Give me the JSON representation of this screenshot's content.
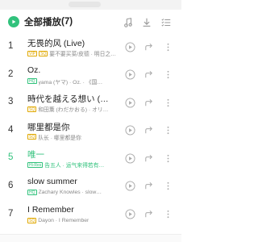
{
  "header": {
    "title": "全部播放",
    "count": "(7)",
    "icons": [
      "playlist-music-icon",
      "download-icon",
      "multi-select-icon"
    ]
  },
  "colors": {
    "accent": "#31c27c",
    "vip": "#e0a800",
    "text": "#222222",
    "sub": "#888888"
  },
  "songs": [
    {
      "num": "1",
      "title": "无畏的风 (Live)",
      "badges": [
        "VIP",
        "SQ"
      ],
      "sub": "要不要买菜/皮德 · 明日之子…"
    },
    {
      "num": "2",
      "title": "Oz.",
      "badges": [
        "HQ"
      ],
      "sub": "yama (ヤマ) · Oz. · 《国…"
    },
    {
      "num": "3",
      "title": "時代を越える想い (穿越…",
      "badges": [
        "SQ"
      ],
      "sub": "和田薫 (わだかおる) · オリ…"
    },
    {
      "num": "4",
      "title": "哪里都是你",
      "badges": [
        "SQ"
      ],
      "sub": "队长 · 哪里都是你"
    },
    {
      "num": "5",
      "title": "唯一",
      "badges": [
        "Hi-Res"
      ],
      "sub": "告五人 · 运气来得若有…"
    },
    {
      "num": "6",
      "title": "slow summer",
      "badges": [
        "HQ"
      ],
      "sub": "Zachary Knowles · slow…"
    },
    {
      "num": "7",
      "title": "I Remember",
      "badges": [
        "SQ"
      ],
      "sub": "Dayon · I Remember"
    }
  ]
}
